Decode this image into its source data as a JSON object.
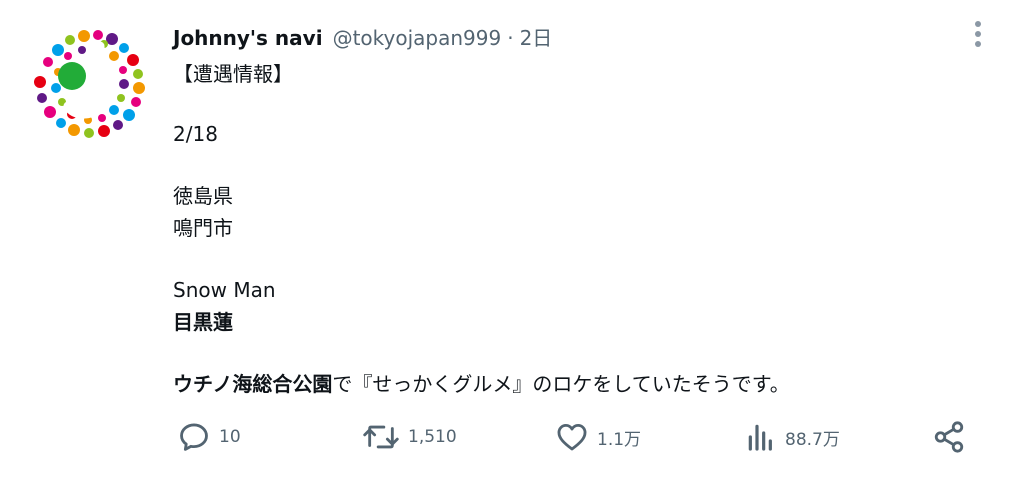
{
  "author": {
    "name": "Johnny's navi",
    "handle": "@tokyojapan999",
    "separator": "·",
    "time": "2日"
  },
  "content": {
    "line1": "【遭遇情報】",
    "line2": "2/18",
    "line3": "徳島県",
    "line4": "鳴門市",
    "line5": "Snow Man",
    "line6": "目黒蓮",
    "line7_bold": "ウチノ海総合公園",
    "line7_rest": "で『せっかくグルメ』のロケをしていたそうです。"
  },
  "actions": {
    "replies": "10",
    "retweets": "1,510",
    "likes": "1.1万",
    "views": "88.7万"
  },
  "icons": [
    "avatar-logo",
    "more-options-icon",
    "reply-icon",
    "retweet-icon",
    "like-icon",
    "views-icon",
    "share-icon"
  ],
  "colors": {
    "text": "#0f1419",
    "secondary": "#536471"
  }
}
